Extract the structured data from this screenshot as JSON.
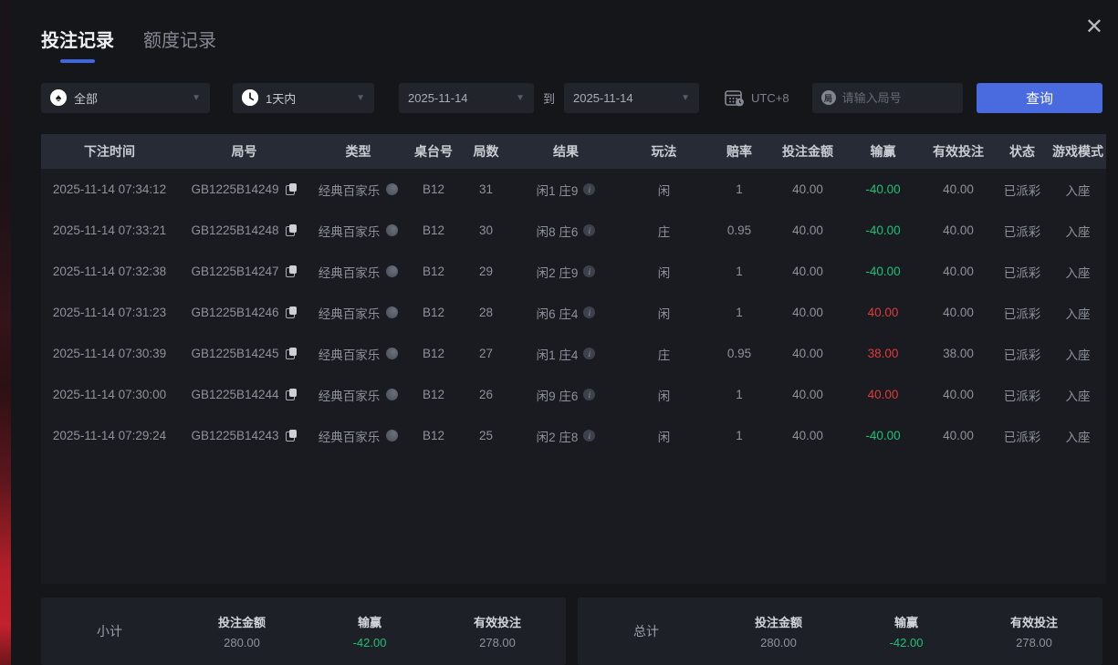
{
  "tabs": [
    {
      "label": "投注记录",
      "active": true
    },
    {
      "label": "额度记录",
      "active": false
    }
  ],
  "close_label": "✕",
  "filters": {
    "game_type_value": "全部",
    "game_type_icon": "spade",
    "spade_glyph": "♠",
    "time_range_value": "1天内",
    "date_from": "2025-11-14",
    "to_label": "到",
    "date_to": "2025-11-14",
    "timezone_label": "UTC+8",
    "round_icon_glyph": "局",
    "round_placeholder": "请输入局号",
    "query_label": "查询"
  },
  "table": {
    "headers": [
      "下注时间",
      "局号",
      "类型",
      "桌台号",
      "局数",
      "结果",
      "玩法",
      "赔率",
      "投注金额",
      "输赢",
      "有效投注",
      "状态",
      "游戏模式"
    ],
    "info_glyph": "i",
    "rows": [
      {
        "time": "2025-11-14 07:34:12",
        "round": "GB1225B14249",
        "type": "经典百家乐",
        "table": "B12",
        "count": "31",
        "result": "闲1 庄9",
        "play": "闲",
        "odds": "1",
        "bet": "40.00",
        "winloss": "-40.00",
        "winloss_color": "green",
        "valid": "40.00",
        "status": "已派彩",
        "mode": "入座"
      },
      {
        "time": "2025-11-14 07:33:21",
        "round": "GB1225B14248",
        "type": "经典百家乐",
        "table": "B12",
        "count": "30",
        "result": "闲8 庄6",
        "play": "庄",
        "odds": "0.95",
        "bet": "40.00",
        "winloss": "-40.00",
        "winloss_color": "green",
        "valid": "40.00",
        "status": "已派彩",
        "mode": "入座"
      },
      {
        "time": "2025-11-14 07:32:38",
        "round": "GB1225B14247",
        "type": "经典百家乐",
        "table": "B12",
        "count": "29",
        "result": "闲2 庄9",
        "play": "闲",
        "odds": "1",
        "bet": "40.00",
        "winloss": "-40.00",
        "winloss_color": "green",
        "valid": "40.00",
        "status": "已派彩",
        "mode": "入座"
      },
      {
        "time": "2025-11-14 07:31:23",
        "round": "GB1225B14246",
        "type": "经典百家乐",
        "table": "B12",
        "count": "28",
        "result": "闲6 庄4",
        "play": "闲",
        "odds": "1",
        "bet": "40.00",
        "winloss": "40.00",
        "winloss_color": "red",
        "valid": "40.00",
        "status": "已派彩",
        "mode": "入座"
      },
      {
        "time": "2025-11-14 07:30:39",
        "round": "GB1225B14245",
        "type": "经典百家乐",
        "table": "B12",
        "count": "27",
        "result": "闲1 庄4",
        "play": "庄",
        "odds": "0.95",
        "bet": "40.00",
        "winloss": "38.00",
        "winloss_color": "red",
        "valid": "38.00",
        "status": "已派彩",
        "mode": "入座"
      },
      {
        "time": "2025-11-14 07:30:00",
        "round": "GB1225B14244",
        "type": "经典百家乐",
        "table": "B12",
        "count": "26",
        "result": "闲9 庄6",
        "play": "闲",
        "odds": "1",
        "bet": "40.00",
        "winloss": "40.00",
        "winloss_color": "red",
        "valid": "40.00",
        "status": "已派彩",
        "mode": "入座"
      },
      {
        "time": "2025-11-14 07:29:24",
        "round": "GB1225B14243",
        "type": "经典百家乐",
        "table": "B12",
        "count": "25",
        "result": "闲2 庄8",
        "play": "闲",
        "odds": "1",
        "bet": "40.00",
        "winloss": "-40.00",
        "winloss_color": "green",
        "valid": "40.00",
        "status": "已派彩",
        "mode": "入座"
      }
    ]
  },
  "summary": {
    "subtotal": {
      "label": "小计",
      "bet_title": "投注金额",
      "bet": "280.00",
      "winloss_title": "输赢",
      "winloss": "-42.00",
      "winloss_color": "green",
      "valid_title": "有效投注",
      "valid": "278.00"
    },
    "total": {
      "label": "总计",
      "bet_title": "投注金额",
      "bet": "280.00",
      "winloss_title": "输赢",
      "winloss": "-42.00",
      "winloss_color": "green",
      "valid_title": "有效投注",
      "valid": "278.00"
    }
  },
  "colors": {
    "accent": "#4a6be0",
    "green": "#1ec077",
    "red": "#e03a3a",
    "tab_underline": "#3f66e0"
  }
}
